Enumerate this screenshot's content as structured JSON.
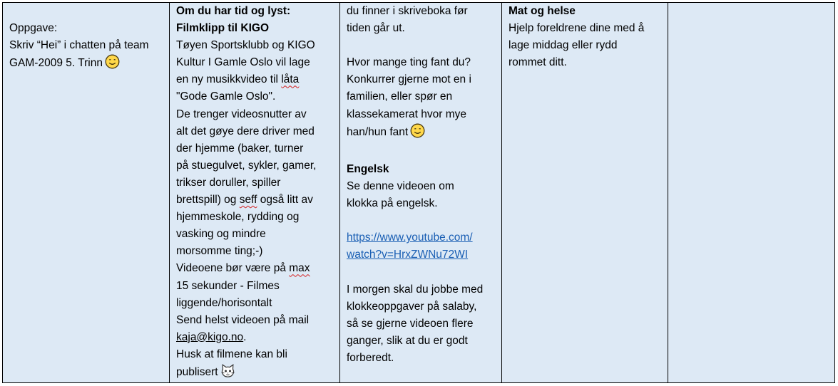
{
  "col1": {
    "oppgave_label": "Oppgave:",
    "line1": "Skriv “Hei” i chatten på team",
    "line2": "GAM-2009 5. Trinn"
  },
  "col2": {
    "heading1": "Om du har tid og lyst:",
    "heading2": "Filmklipp til KIGO",
    "l1": "Tøyen Sportsklubb og KIGO",
    "l2": "Kultur I Gamle Oslo vil lage",
    "l3_a": "en ny musikkvideo til ",
    "l3_b": "låta",
    "l4": "\"Gode Gamle Oslo\".",
    "l5": "De trenger videosnutter av",
    "l6": "alt det gøye dere driver med",
    "l7": "der hjemme (baker, turner",
    "l8": "på stuegulvet, sykler, gamer,",
    "l9": "trikser doruller, spiller",
    "l10_a": "brettspill) og ",
    "l10_b": "seff",
    "l10_c": " også litt av",
    "l11": "hjemmeskole, rydding og",
    "l12": "vasking og mindre",
    "l13": "morsomme ting;-)",
    "l14_a": "Videoene bør være på ",
    "l14_b": "max",
    "l15": "15 sekunder - Filmes",
    "l16": "liggende/horisontalt",
    "l17": "Send helst videoen på mail",
    "l18_a": "kaja@kigo.no",
    "l18_b": ".",
    "l19": "Husk at filmene kan bli",
    "l20": "publisert"
  },
  "col3": {
    "l1": "du finner i skriveboka før",
    "l2": "tiden går ut.",
    "l3": "Hvor mange ting fant du?",
    "l4": "Konkurrer gjerne mot en i",
    "l5": "familien, eller spør en",
    "l6": "klassekamerat hvor mye",
    "l7": "han/hun fant",
    "engelsk_heading": "Engelsk",
    "l8": "Se denne videoen om",
    "l9": "klokka på engelsk.",
    "link1": "https://www.youtube.com/",
    "link2": "watch?v=HrxZWNu72WI",
    "l10": "I morgen skal du jobbe med",
    "l11": "klokkeoppgaver på salaby,",
    "l12": "så se gjerne videoen flere",
    "l13": "ganger, slik at du er godt",
    "l14": "forberedt."
  },
  "col4": {
    "heading": "Mat og helse",
    "l1": "Hjelp foreldrene dine med å",
    "l2": "lage middag eller rydd",
    "l3": "rommet ditt."
  },
  "icons": {
    "smiley": "smiley-face-icon",
    "cat": "cat-face-icon"
  }
}
